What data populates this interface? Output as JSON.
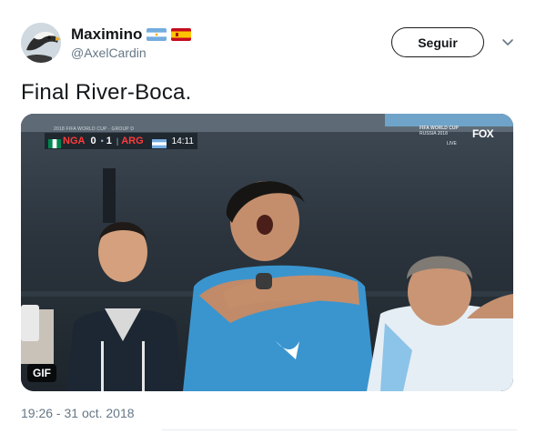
{
  "author": {
    "display_name": "Maximino",
    "handle": "@AxelCardin",
    "avatar_icon": "eagle-avatar-icon",
    "flags": [
      "argentina-flag-icon",
      "spain-flag-icon"
    ]
  },
  "actions": {
    "follow_label": "Seguir",
    "menu_icon": "chevron-down-icon"
  },
  "tweet": {
    "text": "Final River-Boca.",
    "timestamp": "19:26 - 31 oct. 2018"
  },
  "media": {
    "badge": "GIF",
    "scorebug": {
      "tournament": "2018 FIFA WORLD CUP · GROUP D",
      "home_team": "NGA",
      "home_score": "0",
      "away_score": "1",
      "away_team": "ARG",
      "clock": "14:11"
    },
    "broadcast": {
      "event_line1": "FIFA WORLD CUP",
      "event_line2": "RUSSIA 2018",
      "network": "FOX",
      "live": "LIVE"
    }
  },
  "colors": {
    "text_primary": "#14171a",
    "text_secondary": "#657786",
    "score_team": "#ff3b3b"
  }
}
